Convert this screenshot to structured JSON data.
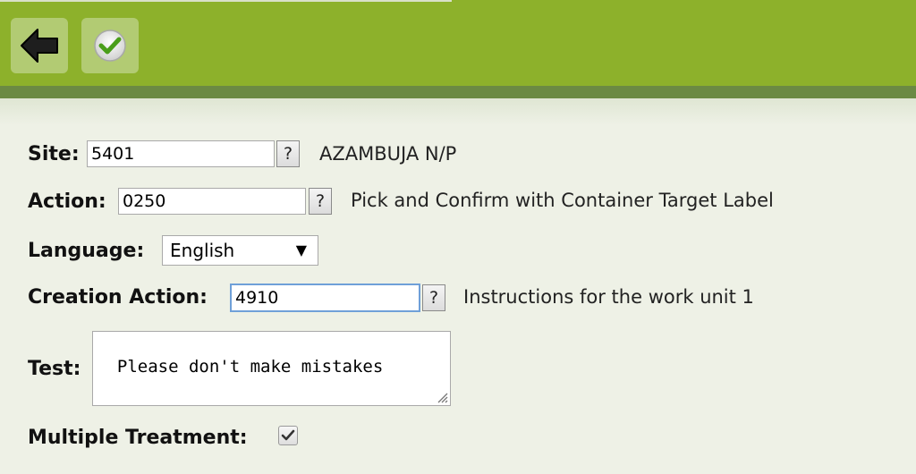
{
  "toolbar": {
    "back_icon": "arrow-left-icon",
    "confirm_icon": "checkmark-icon",
    "color": "#8db12b"
  },
  "form": {
    "site": {
      "label": "Site:",
      "value": "5401",
      "help": "?",
      "description": "AZAMBUJA N/P"
    },
    "action": {
      "label": "Action:",
      "value": "0250",
      "help": "?",
      "description": "Pick and Confirm with Container Target Label"
    },
    "language": {
      "label": "Language:",
      "selected": "English"
    },
    "creation_action": {
      "label": "Creation Action:",
      "value": "4910",
      "help": "?",
      "description": "Instructions for the work unit 1"
    },
    "test": {
      "label": "Test:",
      "value": "Please don't make mistakes"
    },
    "multiple_treatment": {
      "label": "Multiple Treatment:",
      "checked": true
    }
  }
}
